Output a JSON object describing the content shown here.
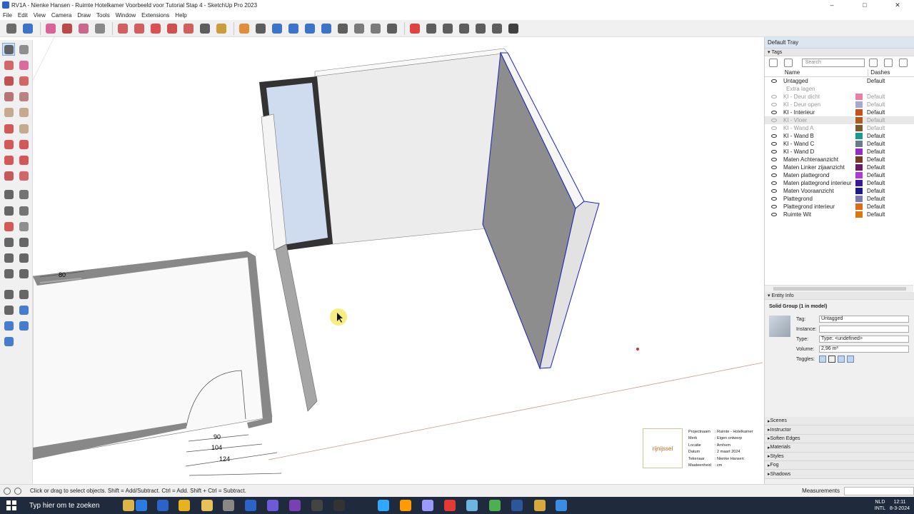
{
  "window": {
    "title": "RV1A - Nienke Hansen - Ruimte Hotelkamer Voorbeeld voor Tutorial Stap 4 - SketchUp Pro 2023",
    "controls": [
      "–",
      "□",
      "✕"
    ]
  },
  "menu": [
    "File",
    "Edit",
    "View",
    "Camera",
    "Draw",
    "Tools",
    "Window",
    "Extensions",
    "Help"
  ],
  "toolbar_icons": [
    "search-icon",
    "select-icon",
    "eraser-icon",
    "pencil-icon",
    "lasso-icon",
    "paint-icon",
    "push-pull-icon",
    "follow-me-icon",
    "move-icon",
    "rotate-icon",
    "scale-icon",
    "tape-icon",
    "text-icon",
    "orbit-icon",
    "pan-icon",
    "zoom-icon",
    "zoom-extents-icon",
    "section-icon",
    "section-display-icon",
    "layers-icon",
    "styles-icon",
    "components-icon",
    "warehouse-icon",
    "model-info-icon",
    "solid-tools-icon",
    "camera-icon",
    "walk-icon",
    "person-icon",
    "photo-icon",
    "settings-icon"
  ],
  "left_tools": [
    "select-icon",
    "orbit-icon",
    "paint-icon",
    "eraser-icon",
    "line-icon",
    "freehand-icon",
    "rectangle-icon",
    "rotated-rect-icon",
    "circle-icon",
    "polygon-icon",
    "arc-icon",
    "pie-icon",
    "move-icon",
    "push-pull-icon",
    "rotate-icon",
    "follow-me-icon",
    "scale-icon",
    "offset-icon",
    "tape-icon",
    "dimension-icon",
    "protractor-icon",
    "text-icon",
    "axes-icon",
    "3dtext-icon",
    "orbit-icon",
    "pan-icon",
    "zoom-icon",
    "zoom-window-icon",
    "zoom-extents-icon",
    "previous-icon",
    "walk-icon",
    "footprints-icon",
    "look-around-icon",
    "section-icon",
    "position-camera-icon",
    "section-plane-icon",
    "section-cuts-icon"
  ],
  "viewport": {
    "dimensions": [
      "80",
      "90",
      "104",
      "124"
    ],
    "titleblock": {
      "logo": "rijnijssel",
      "rows": [
        {
          "label": "Projectnaam",
          "value": ": Ruimte - Hotelkamer"
        },
        {
          "label": "Merk",
          "value": ": Eigen ontwerp"
        },
        {
          "label": "Locatie",
          "value": ": Arnhem"
        },
        {
          "label": "Datum",
          "value": ": 2 maart 2024"
        },
        {
          "label": "Tekenaar",
          "value": ": Nienke Hansen"
        },
        {
          "label": "Maateenheid",
          "value": ": cm"
        }
      ]
    }
  },
  "tray": {
    "title": "Default Tray",
    "tags_section": "Tags",
    "search_placeholder": "Search",
    "col_name": "Name",
    "col_dashes": "Dashes",
    "tags": [
      {
        "name": "Untagged",
        "color": "",
        "dashes": "Default",
        "visible": true,
        "dim": false,
        "indent": false
      },
      {
        "name": "Extra lagen",
        "color": "",
        "dashes": "",
        "visible": null,
        "dim": true,
        "indent": true
      },
      {
        "name": "KI - Deur dicht",
        "color": "#e97fa8",
        "dashes": "Default",
        "visible": false,
        "dim": true,
        "indent": false
      },
      {
        "name": "KI - Deur open",
        "color": "#a8a8c8",
        "dashes": "Default",
        "visible": false,
        "dim": true,
        "indent": false
      },
      {
        "name": "KI - Interieur",
        "color": "#c8501a",
        "dashes": "Default",
        "visible": true,
        "dim": false,
        "indent": false
      },
      {
        "name": "KI - Vloer",
        "color": "#b05a1f",
        "dashes": "Default",
        "visible": false,
        "dim": true,
        "indent": false,
        "selected": true
      },
      {
        "name": "KI - Wand A",
        "color": "#7a5a2a",
        "dashes": "Default",
        "visible": false,
        "dim": true,
        "indent": false
      },
      {
        "name": "KI - Wand B",
        "color": "#1a9a8f",
        "dashes": "Default",
        "visible": true,
        "dim": false,
        "indent": false
      },
      {
        "name": "KI - Wand C",
        "color": "#6a7d86",
        "dashes": "Default",
        "visible": true,
        "dim": false,
        "indent": false
      },
      {
        "name": "KI - Wand D",
        "color": "#9a2ac8",
        "dashes": "Default",
        "visible": true,
        "dim": false,
        "indent": false
      },
      {
        "name": "Maten Achteraanzicht",
        "color": "#7a3a24",
        "dashes": "Default",
        "visible": true,
        "dim": false,
        "indent": false
      },
      {
        "name": "Maten Linker zijaanzicht",
        "color": "#6a1a6a",
        "dashes": "Default",
        "visible": true,
        "dim": false,
        "indent": false
      },
      {
        "name": "Maten plattegrond",
        "color": "#b03acf",
        "dashes": "Default",
        "visible": true,
        "dim": false,
        "indent": false
      },
      {
        "name": "Maten plattegrond interieur",
        "color": "#3a1a9a",
        "dashes": "Default",
        "visible": true,
        "dim": false,
        "indent": false
      },
      {
        "name": "Maten Vooraanzicht",
        "color": "#1a1a8a",
        "dashes": "Default",
        "visible": true,
        "dim": false,
        "indent": false
      },
      {
        "name": "Plattegrond",
        "color": "#7a7ab0",
        "dashes": "Default",
        "visible": true,
        "dim": false,
        "indent": false
      },
      {
        "name": "Plattegrond interieur",
        "color": "#e06a1a",
        "dashes": "Default",
        "visible": true,
        "dim": false,
        "indent": false
      },
      {
        "name": "Ruimte Wit",
        "color": "#d8780f",
        "dashes": "Default",
        "visible": true,
        "dim": false,
        "indent": false
      }
    ],
    "entity_info": {
      "title": "Entity Info",
      "heading": "Solid Group (1 in model)",
      "tag_label": "Tag:",
      "tag_value": "Untagged",
      "instance_label": "Instance:",
      "instance_value": "",
      "type_label": "Type:",
      "type_value": "Type: <undefined>",
      "volume_label": "Volume:",
      "volume_value": "2,96 m³",
      "toggles_label": "Toggles:"
    },
    "collapsed_panels": [
      "Scenes",
      "Instructor",
      "Soften Edges",
      "Materials",
      "Styles",
      "Fog",
      "Shadows"
    ]
  },
  "status": {
    "hint": "Click or drag to select objects. Shift = Add/Subtract. Ctrl = Add. Shift + Ctrl = Subtract.",
    "measurements_label": "Measurements",
    "measurements_value": ""
  },
  "taskbar": {
    "search_text": "Typ hier om te zoeken",
    "lang": "NLD",
    "layout": "INTL",
    "time": "12:11",
    "date": "8-3-2024"
  }
}
